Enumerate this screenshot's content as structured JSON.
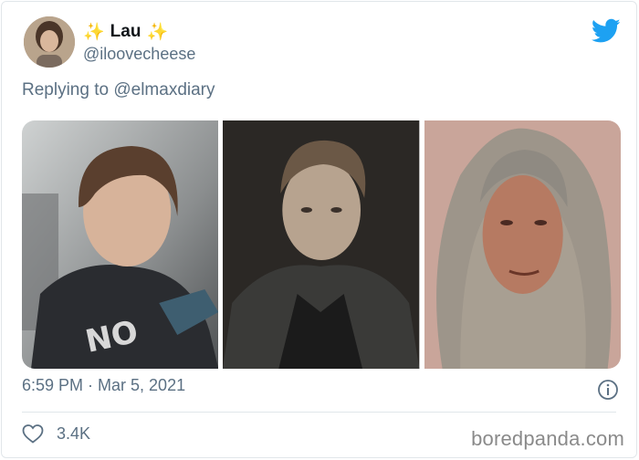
{
  "tweet": {
    "display_name": "Lau",
    "sparkle_left": "✨",
    "sparkle_right": "✨",
    "handle": "@iloovecheese",
    "reply_prefix": "Replying to",
    "reply_mention": "@elmaxdiary",
    "timestamp": "6:59 PM · Mar 5, 2021",
    "like_count": "3.4K",
    "media_count": 3
  },
  "watermark": "boredpanda.com",
  "icons": [
    "twitter-bird-icon",
    "info-icon",
    "heart-icon"
  ],
  "colors": {
    "twitter_blue": "#1da1f2",
    "secondary_text": "#5b7083",
    "sparkle": "#f5bb2b"
  }
}
